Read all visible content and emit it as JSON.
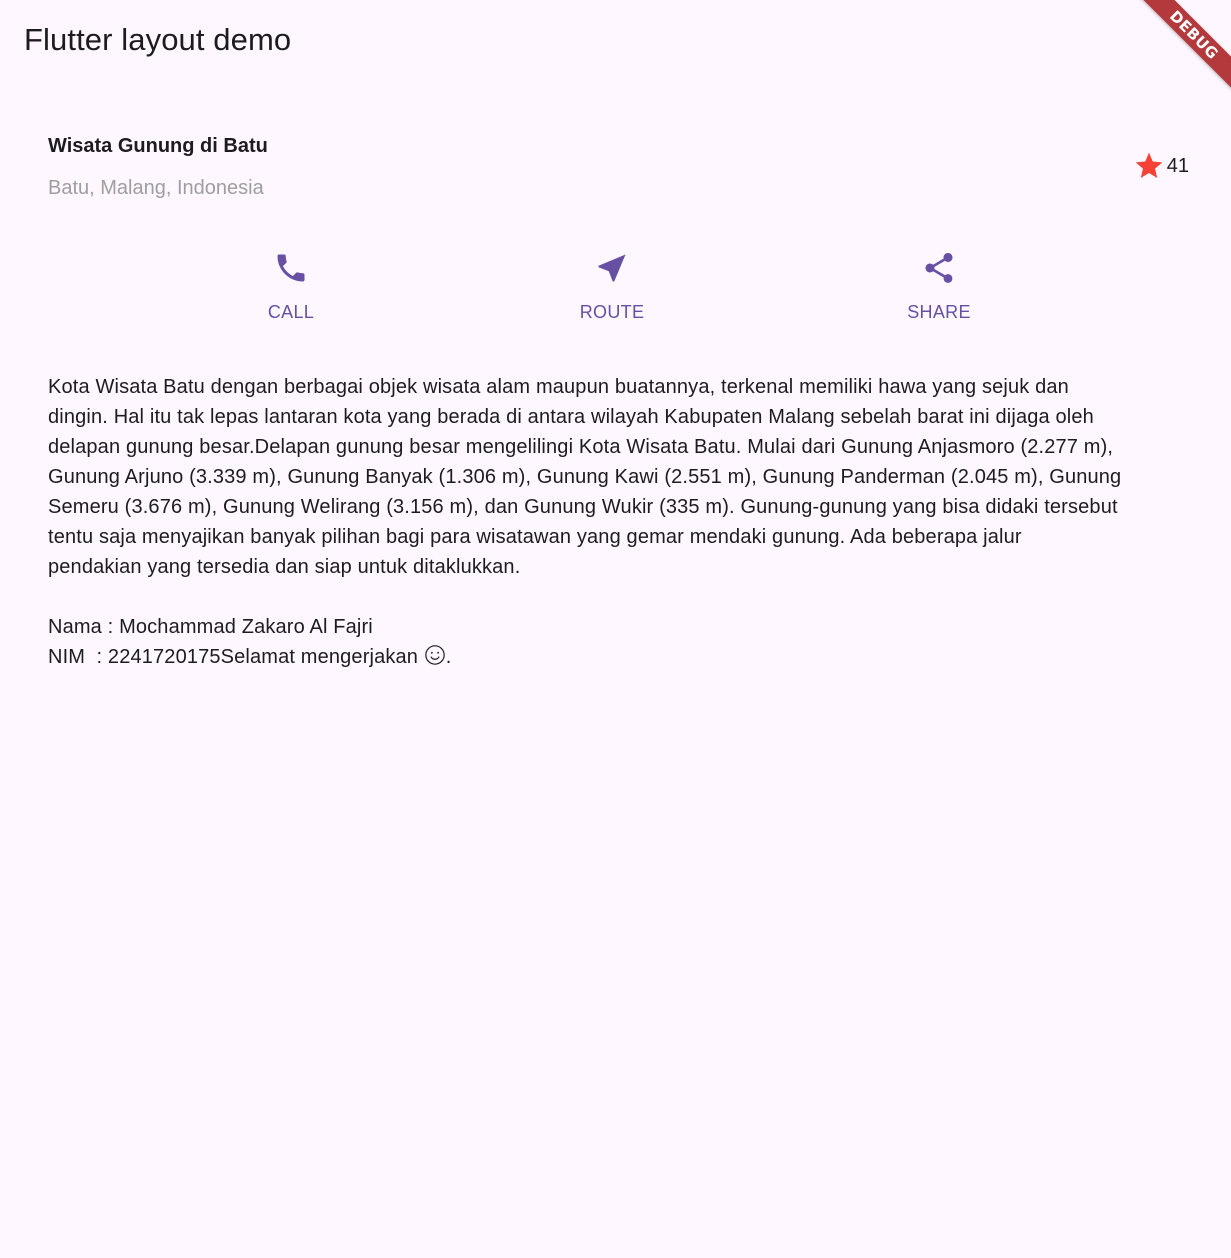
{
  "app_bar": {
    "title": "Flutter layout demo",
    "debug_banner": "DEBUG",
    "debug_color": "#b3393c"
  },
  "title_section": {
    "name": "Wisata Gunung di Batu",
    "location": "Batu, Malang, Indonesia",
    "rating_icon": "star-icon",
    "rating_color": "#f44336",
    "rating_count": "41"
  },
  "buttons": {
    "accent_color": "#6750a4",
    "items": [
      {
        "icon": "phone-icon",
        "label": "CALL"
      },
      {
        "icon": "near-me-icon",
        "label": "ROUTE"
      },
      {
        "icon": "share-icon",
        "label": "SHARE"
      }
    ]
  },
  "text_section": {
    "body": "Kota Wisata Batu dengan berbagai objek wisata alam maupun buatannya, terkenal memiliki hawa yang sejuk dan\ndingin. Hal itu tak lepas lantaran kota yang berada di antara wilayah Kabupaten Malang sebelah barat ini dijaga oleh\ndelapan gunung besar.Delapan gunung besar mengelilingi Kota Wisata Batu. Mulai dari Gunung Anjasmoro (2.277 m),\nGunung Arjuno (3.339 m), Gunung Banyak (1.306 m), Gunung Kawi (2.551 m), Gunung Panderman (2.045 m), Gunung\nSemeru (3.676 m), Gunung Welirang (3.156 m), dan Gunung Wukir (335 m). Gunung-gunung yang bisa didaki tersebut\ntentu saja menyajikan banyak pilihan bagi para wisatawan yang gemar mendaki gunung. Ada beberapa jalur\npendakian yang tersedia dan siap untuk ditaklukkan.\n\nNama : Mochammad Zakaro Al Fajri\nNIM  : 2241720175Selamat mengerjakan ",
    "smiley_icon": "smiley-icon",
    "ending": "."
  },
  "background_color": "#fef7ff"
}
